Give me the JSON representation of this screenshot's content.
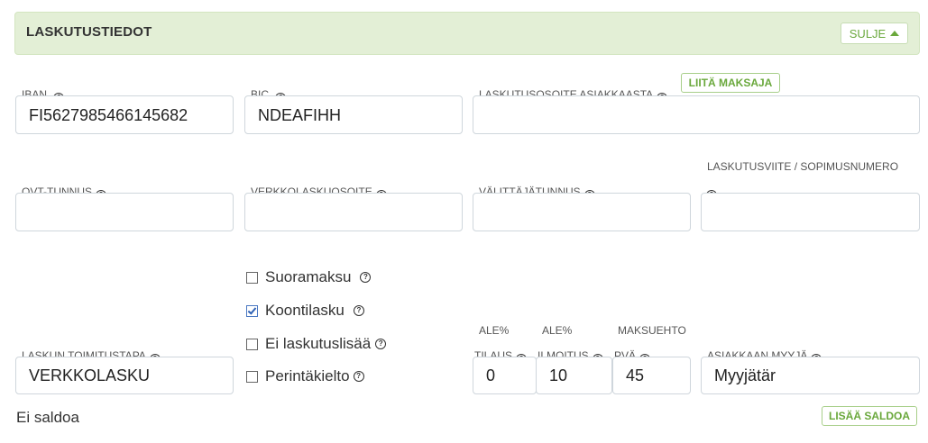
{
  "header": {
    "title": "LASKUTUSTIEDOT",
    "close_label": "SULJE"
  },
  "fields": {
    "iban": {
      "label": "IBAN.",
      "value": "FI5627985466145682"
    },
    "bic": {
      "label": "BIC.",
      "value": "NDEAFIHH"
    },
    "billing_address": {
      "label": "LASKUTUSOSOITE ASIAKKAASTA",
      "value": "",
      "attach_label": "LIITÄ MAKSAJA"
    },
    "ovt": {
      "label": "OVT-TUNNUS",
      "value": ""
    },
    "einvoice_address": {
      "label": "VERKKOLASKUOSOITE",
      "value": ""
    },
    "operator_id": {
      "label": "VÄLITTÄJÄTUNNUS",
      "value": ""
    },
    "billing_reference": {
      "label": "LASKUTUSVIITE / SOPIMUSNUMERO",
      "value": ""
    },
    "delivery_method": {
      "label": "LASKUN TOIMITUSTAPA",
      "value": "VERKKOLASKU"
    },
    "discount_order": {
      "label_top": "ALE%",
      "label": "TILAUS",
      "value": "0"
    },
    "discount_notice": {
      "label_top": "ALE%",
      "label": "ILMOITUS",
      "value": "10"
    },
    "payment_term": {
      "label_top": "MAKSUEHTO",
      "label": "PVÄ",
      "value": "45"
    },
    "seller": {
      "label": "ASIAKKAAN MYYJÄ",
      "value": "Myyjätär"
    }
  },
  "checkboxes": [
    {
      "label": "Suoramaksu",
      "checked": false
    },
    {
      "label": "Koontilasku",
      "checked": true
    },
    {
      "label": "Ei laskutuslisää",
      "checked": false
    },
    {
      "label": "Perintäkielto",
      "checked": false
    }
  ],
  "balance": {
    "text": "Ei saldoa",
    "add_label": "LISÄÄ SALDOA"
  },
  "icons": {
    "help": "help-circle-icon",
    "caret": "caret-up-icon"
  },
  "colors": {
    "accent_green": "#6aa83c",
    "header_bg": "#e3efd6"
  }
}
